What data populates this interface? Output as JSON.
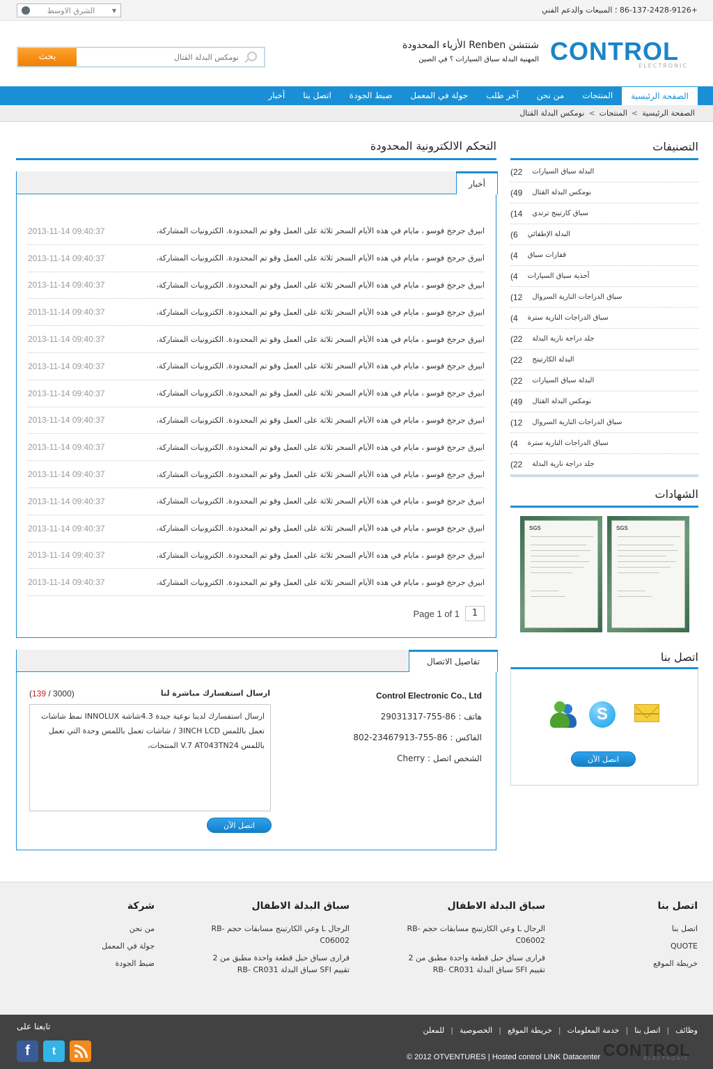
{
  "topbar": {
    "region": "الشرق الاوسط",
    "phone": "+86-137-2428-9126 ؛ المبيعات والدعم الفني"
  },
  "header": {
    "logo_text": "CONTROL",
    "logo_sub": "ELECTRONIC",
    "company_name": "شنتشن Renben الأزياء المحدودة",
    "company_sub": "المهنية البدلة سباق السيارات ؟ في الصين",
    "search_button": "بحث",
    "search_placeholder": "نومكس البدلة القتال"
  },
  "nav": {
    "items": [
      "الصفحة الرئيسية",
      "المنتجات",
      "من نحن",
      "آخر طلب",
      "جولة في المعمل",
      "ضبط الجودة",
      "اتصل بنا",
      "أخبار"
    ],
    "active_index": 0
  },
  "breadcrumb": {
    "items": [
      "الصفحة الرئيسية",
      "المنتجات",
      "نومكس البدلة القتال"
    ],
    "sep": ">"
  },
  "main": {
    "title": "التحكم الالكترونية المحدودة",
    "news_tab": "أخبار",
    "news": [
      {
        "title": "ابيرق جرجخ فوسو ، مايام في هذه الأيام السحر ثلاثة على العمل وقو تم المحدودة. الكترونيات المشاركة، المحدودة ....",
        "date": "2013-11-14 09:40:37"
      },
      {
        "title": "ابيرق جرجخ فوسو ، مايام في هذه الأيام السحر ثلاثة على العمل وقو تم المحدودة. الكترونيات المشاركة، المحدودة ....",
        "date": "2013-11-14 09:40:37"
      },
      {
        "title": "ابيرق جرجخ فوسو ، مايام في هذه الأيام السحر ثلاثة على العمل وقو تم المحدودة. الكترونيات المشاركة، المحدودة ....",
        "date": "2013-11-14 09:40:37"
      },
      {
        "title": "ابيرق جرجخ فوسو ، مايام في هذه الأيام السحر ثلاثة على العمل وقو تم المحدودة. الكترونيات المشاركة، المحدودة ....",
        "date": "2013-11-14 09:40:37"
      },
      {
        "title": "ابيرق جرجخ فوسو ، مايام في هذه الأيام السحر ثلاثة على العمل وقو تم المحدودة. الكترونيات المشاركة، المحدودة ....",
        "date": "2013-11-14 09:40:37"
      },
      {
        "title": "ابيرق جرجخ فوسو ، مايام في هذه الأيام السحر ثلاثة على العمل وقو تم المحدودة. الكترونيات المشاركة، المحدودة ....",
        "date": "2013-11-14 09:40:37"
      },
      {
        "title": "ابيرق جرجخ فوسو ، مايام في هذه الأيام السحر ثلاثة على العمل وقو تم المحدودة. الكترونيات المشاركة، المحدودة ....",
        "date": "2013-11-14 09:40:37"
      },
      {
        "title": "ابيرق جرجخ فوسو ، مايام في هذه الأيام السحر ثلاثة على العمل وقو تم المحدودة. الكترونيات المشاركة، المحدودة ....",
        "date": "2013-11-14 09:40:37"
      },
      {
        "title": "ابيرق جرجخ فوسو ، مايام في هذه الأيام السحر ثلاثة على العمل وقو تم المحدودة. الكترونيات المشاركة، المحدودة ....",
        "date": "2013-11-14 09:40:37"
      },
      {
        "title": "ابيرق جرجخ فوسو ، مايام في هذه الأيام السحر ثلاثة على العمل وقو تم المحدودة. الكترونيات المشاركة، المحدودة ....",
        "date": "2013-11-14 09:40:37"
      },
      {
        "title": "ابيرق جرجخ فوسو ، مايام في هذه الأيام السحر ثلاثة على العمل وقو تم المحدودة. الكترونيات المشاركة، المحدودة ....",
        "date": "2013-11-14 09:40:37"
      },
      {
        "title": "ابيرق جرجخ فوسو ، مايام في هذه الأيام السحر ثلاثة على العمل وقو تم المحدودة. الكترونيات المشاركة، المحدودة ....",
        "date": "2013-11-14 09:40:37"
      },
      {
        "title": "ابيرق جرجخ فوسو ، مايام في هذه الأيام السحر ثلاثة على العمل وقو تم المحدودة. الكترونيات المشاركة، المحدودة ....",
        "date": "2013-11-14 09:40:37"
      },
      {
        "title": "ابيرق جرجخ فوسو ، مايام في هذه الأيام السحر ثلاثة على العمل وقو تم المحدودة. الكترونيات المشاركة، المحدودة ....",
        "date": "2013-11-14 09:40:37"
      }
    ],
    "pager_text": "Page 1 of 1",
    "pager_current": "1",
    "contact_tab": "تفاصيل الاتصال",
    "contact_info": {
      "company": "Control Electronic Co., Ltd",
      "phone": "هاتف : 86-755-29031317",
      "fax": "الفاكس : 86-755-23467913-802",
      "person": "الشخص اتصل : Cherry"
    },
    "inquiry": {
      "title": "ارسال استفسارك مباشرة لنا",
      "count_used": "139",
      "count_max": "3000",
      "text": "ارسال استفسارك لدينا نوعية جيدة 4.3شاشة INNOLUX نمط شاشات تعمل باللمس 3INCH LCD / شاشات تعمل باللمس وحدة التي تعمل باللمس V.7 AT043TN24 المنتجات،",
      "button": "اتصل الآن"
    }
  },
  "sidebar": {
    "categories_title": "التصنيفات",
    "categories": [
      {
        "label": "البدلة سباق السيارات",
        "count": "22)"
      },
      {
        "label": "نومكس البدلة القتال",
        "count": "49)"
      },
      {
        "label": "سباق كارتينج ترتدي",
        "count": "14)"
      },
      {
        "label": "البدلة الإطفائي",
        "count": "6)"
      },
      {
        "label": "قفازات سباق",
        "count": "4)"
      },
      {
        "label": "أحذية سباق السيارات",
        "count": "4)"
      },
      {
        "label": "سباق الدراجات النارية السروال",
        "count": "12)"
      },
      {
        "label": "سباق الدراجات النارية سترة",
        "count": "4)"
      },
      {
        "label": "جلد دراجة نارية البدلة",
        "count": "22)"
      },
      {
        "label": "البدلة الكارتينج",
        "count": "22)"
      },
      {
        "label": "البدلة سباق السيارات",
        "count": "22)"
      },
      {
        "label": "نومكس البدلة القتال",
        "count": "49)"
      },
      {
        "label": "سباق الدراجات النارية السروال",
        "count": "12)"
      },
      {
        "label": "سباق الدراجات النارية سترة",
        "count": "4)"
      },
      {
        "label": "جلد دراجة نارية البدلة",
        "count": "22)"
      }
    ],
    "certs_title": "الشهادات",
    "cert_label": "SGS",
    "contact_title": "اتصل بنا",
    "contact_button": "اتصل الآن",
    "skype_letter": "S"
  },
  "footer": {
    "col1": {
      "title": "اتصل بنا",
      "links": [
        "اتصل بنا",
        "QUOTE",
        "خريطة الموقع"
      ]
    },
    "col2": {
      "title": "سباق البدلة الاطفال",
      "links": [
        "الرجال L وعي الكارتينج مسابقات حجم RB- C06002",
        "قرارى سباق حبل قطعة واحدة مطبق من 2 تقييم SFI سباق البدلة RB- CR031"
      ]
    },
    "col3": {
      "title": "سباق البدلة الاطفال",
      "links": [
        "الرجال L وعي الكارتينج مسابقات حجم RB- C06002",
        "قرارى سباق حبل قطعة واحدة مطبق من 2 تقييم SFI سباق البدلة RB- CR031"
      ]
    },
    "col4": {
      "title": "شركة",
      "links": [
        "من نحن",
        "جولة في المعمل",
        "ضبط الجودة"
      ]
    },
    "follow": "تابعنا على",
    "bottom_links": [
      "وظائف",
      "اتصل بنا",
      "خدمة المعلومات",
      "خريطة الموقع",
      "الخصوصية",
      "للمعلن"
    ],
    "copyright": "© 2012 OTVENTURES | Hosted control LINK Datacenter",
    "logo_text": "CONTROL",
    "logo_sub": "ELECTRONIC",
    "fb_letter": "f",
    "tw_letter": "t"
  }
}
